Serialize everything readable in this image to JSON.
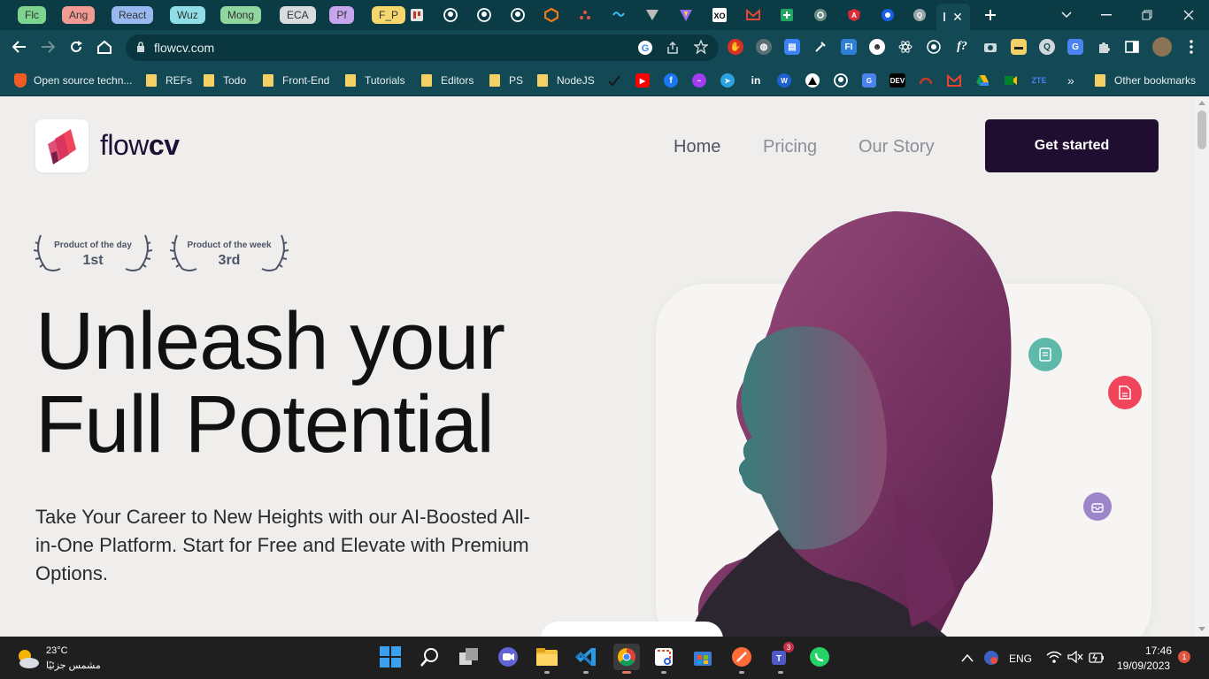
{
  "browser": {
    "tabs": [
      {
        "label": "Flc",
        "color": "#7dd48e"
      },
      {
        "label": "Ang",
        "color": "#f29b93"
      },
      {
        "label": "React",
        "color": "#9ab8f0"
      },
      {
        "label": "Wuz",
        "color": "#8fdde6"
      },
      {
        "label": "Mong",
        "color": "#8fd6a0"
      },
      {
        "label": "ECA",
        "color": "#d8dcdf"
      },
      {
        "label": "Pf",
        "color": "#c6a4ee"
      },
      {
        "label": "F_P",
        "color": "#f5d76e"
      }
    ],
    "address_url": "flowcv.com",
    "bookmarks": {
      "first": "Open source techn...",
      "folders": [
        "REFs",
        "Todo",
        "Front-End",
        "Tutorials",
        "Editors",
        "PS",
        "NodeJS"
      ],
      "other": "Other bookmarks",
      "overflow": "»"
    }
  },
  "site": {
    "logo_light": "flow",
    "logo_bold": "cv",
    "nav": {
      "home": "Home",
      "pricing": "Pricing",
      "story": "Our Story"
    },
    "cta": "Get started",
    "awards": [
      {
        "label": "Product of the day",
        "rank": "1st"
      },
      {
        "label": "Product of the week",
        "rank": "3rd"
      }
    ],
    "headline_line1": "Unleash your",
    "headline_line2": "Full Potential",
    "subhead": "Take Your Career to New Heights with our AI-Boosted All-in-One Platform. Start for Free and Elevate with Premium Options."
  },
  "taskbar": {
    "weather_temp": "23°C",
    "weather_desc": "مشمس جزئيًا",
    "lang": "ENG",
    "time": "17:46",
    "date": "19/09/2023",
    "notification_count": "1",
    "teams_badge": "3"
  },
  "colors": {
    "accent_brand": "#f0455b",
    "cta_bg": "#1f0e30",
    "chrome_bg": "#124954"
  }
}
